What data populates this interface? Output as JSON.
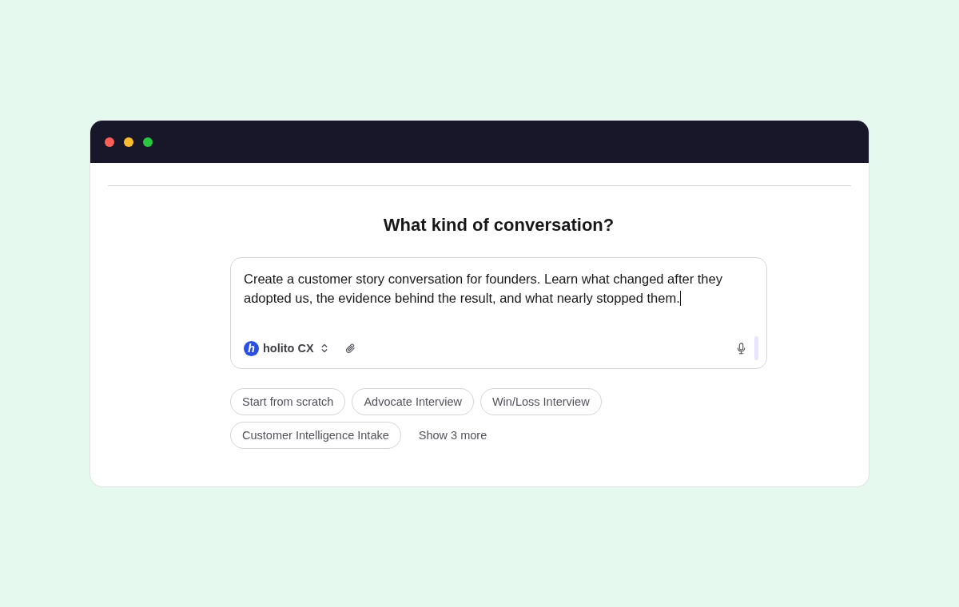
{
  "window": {
    "controls": [
      {
        "color": "#ff5f57"
      },
      {
        "color": "#febc2e"
      },
      {
        "color": "#28c840"
      }
    ]
  },
  "heading": "What kind of conversation?",
  "prompt": {
    "value": "Create a customer story conversation for founders. Learn what changed after they adopted us, the evidence behind the result, and what nearly stopped them.",
    "workspace": {
      "logo_letter": "h",
      "name": "holito CX"
    }
  },
  "templates": [
    {
      "label": "Start from scratch"
    },
    {
      "label": "Advocate Interview"
    },
    {
      "label": "Win/Loss Interview"
    },
    {
      "label": "Customer Intelligence Intake"
    }
  ],
  "show_more": "Show 3 more"
}
